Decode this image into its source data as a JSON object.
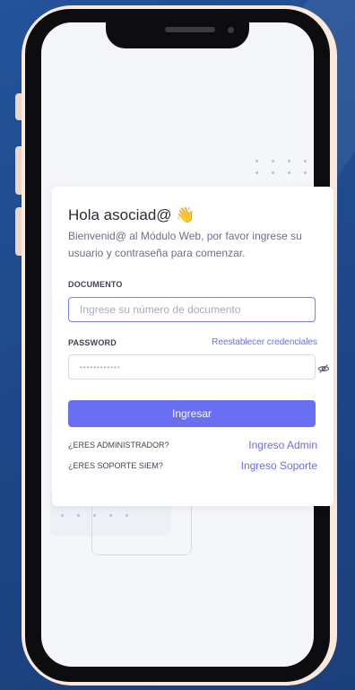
{
  "login": {
    "greeting": "Hola asociad@",
    "wave_emoji": "👋",
    "welcome": "Bienvenid@ al Módulo Web, por favor ingrese su usuario y contraseña para comenzar.",
    "document_label": "DOCUMENTO",
    "document_placeholder": "Ingrese su número de documento",
    "password_label": "PASSWORD",
    "reset_link": "Reestablecer credenciales",
    "password_value": "••••••••••••",
    "submit_label": "Ingresar",
    "admin_question": "¿ERES ADMINISTRADOR?",
    "admin_link": "Ingreso Admin",
    "support_question": "¿ERES SOPORTE SIEM?",
    "support_link": "Ingreso Soporte"
  },
  "icons": {
    "password_toggle": "eye-slash-icon"
  },
  "colors": {
    "accent": "#6a6ff2",
    "background": "#1f4a8c",
    "screen": "#f5f6fa"
  }
}
